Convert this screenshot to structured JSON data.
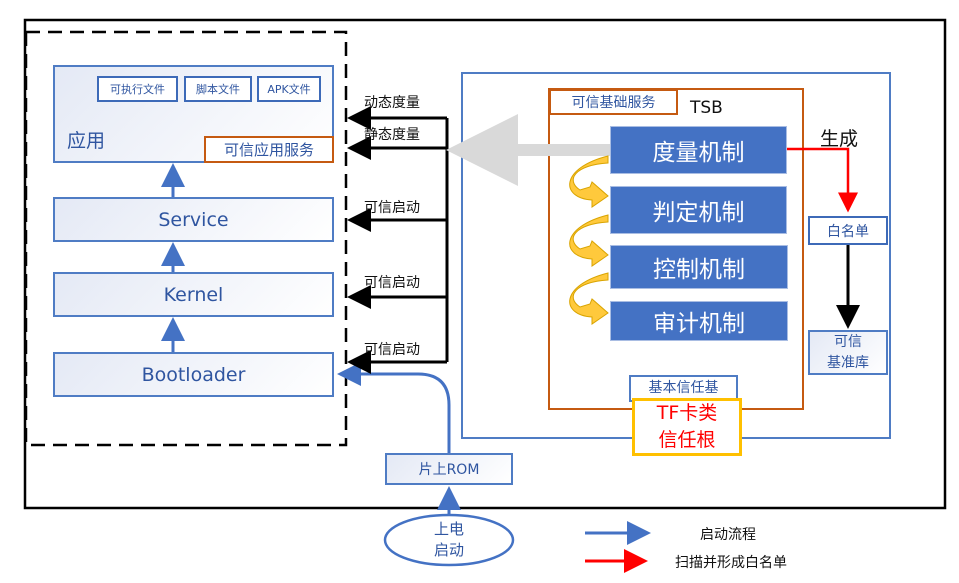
{
  "app": {
    "title": "应用",
    "files": [
      "可执行文件",
      "脚本文件",
      "APK文件"
    ],
    "service": "可信应用服务"
  },
  "layers": {
    "service": "Service",
    "kernel": "Kernel",
    "bootloader": "Bootloader"
  },
  "measure_labels": {
    "dynamic": "动态度量",
    "static": "静态度量",
    "boot1": "可信启动",
    "boot2": "可信启动",
    "boot3": "可信启动"
  },
  "tsb": {
    "label": "TSB",
    "base_service": "可信基础服务",
    "mechanisms": [
      "度量机制",
      "判定机制",
      "控制机制",
      "审计机制"
    ],
    "base_trust": "基本信任基",
    "root": "TF卡类信任根"
  },
  "generate": "生成",
  "whitelist": "白名单",
  "trusted_db": {
    "line1": "可信",
    "line2": "基准库"
  },
  "rom": "片上ROM",
  "power": {
    "line1": "上电",
    "line2": "启动"
  },
  "legend": {
    "boot_flow": "启动流程",
    "scan": "扫描并形成白名单"
  },
  "colors": {
    "blue": "#4472c4",
    "red": "#ff0000",
    "orange": "#c55a11",
    "gold": "#ffc000"
  }
}
